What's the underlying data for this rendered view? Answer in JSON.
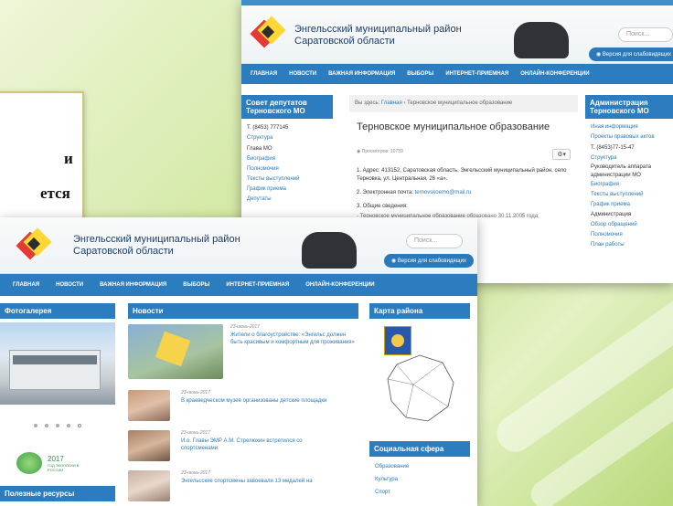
{
  "slide": {
    "line1": "и",
    "line2": "ется"
  },
  "back": {
    "site_line1": "Энгельсский муниципальный район",
    "site_line2": "Саратовской области",
    "search_placeholder": "Поиск...",
    "blind_version": "Версия для слабовидящих",
    "nav": [
      "ГЛАВНАЯ",
      "НОВОСТИ",
      "ВАЖНАЯ ИНФОРМАЦИЯ",
      "ВЫБОРЫ",
      "ИНТЕРНЕТ-ПРИЕМНАЯ",
      "ОНЛАЙН-КОНФЕРЕНЦИИ"
    ],
    "left_title": "Совет депутатов Терновского МО",
    "left_items": [
      "Т. (8453) 777145",
      "Структура",
      "Глава МО",
      "Биография",
      "Полномочия",
      "Тексты выступлений",
      "График приема",
      "Депутаты"
    ],
    "breadcrumb_prefix": "Вы здесь:",
    "breadcrumb_home": "Главная",
    "breadcrumb_current": "Терновское муниципальное образование",
    "page_title": "Терновское муниципальное образование",
    "views": "Просмотров: 10739",
    "para1": "1. Адрес: 413152, Саратовская область, Энгельсский муниципальный район, село Терновка, ул. Центральная, 26 «а».",
    "para2_label": "2. Электронная почта:",
    "para2_email": "ternovskoemo@mail.ru",
    "para3": "3. Общие сведения:",
    "para3_text": "- Терновское муниципальное образование образовано 30.11.2005 года;",
    "right_title": "Администрация Терновского МО",
    "right_items": [
      "Иная информация",
      "Проекты правовых актов",
      "Т. (8453)77-15-47",
      "Структура",
      "Руководитель аппарата администрации МО",
      "Биография",
      "Тексты выступлений",
      "График приема",
      "Администрация",
      "Обзор обращений",
      "Полномочия",
      "План работы"
    ]
  },
  "front": {
    "site_line1": "Энгельсский муниципальный район",
    "site_line2": "Саратовской области",
    "search_placeholder": "Поиск...",
    "blind_version": "Версия для слабовидящих",
    "nav": [
      "ГЛАВНАЯ",
      "НОВОСТИ",
      "ВАЖНАЯ ИНФОРМАЦИЯ",
      "ВЫБОРЫ",
      "ИНТЕРНЕТ-ПРИЕМНАЯ",
      "ОНЛАЙН-КОНФЕРЕНЦИИ"
    ],
    "gallery_title": "Фотогалерея",
    "news_title": "Новости",
    "map_title": "Карта района",
    "social_title": "Социальная сфера",
    "social_items": [
      "Образование",
      "Культура",
      "Спорт"
    ],
    "eco_year": "2017",
    "eco_text": "ГОД ЭКОЛОГИИ В РОССИИ",
    "resources_title": "Полезные ресурсы",
    "news": [
      {
        "date": "23-июнь-2017",
        "title": "Жители о благоустройстве: «Энгельс должен быть красивым и комфортным для проживания»"
      },
      {
        "date": "23-июнь-2017",
        "title": "В краеведческом музее организованы детские площадки"
      },
      {
        "date": "23-июнь-2017",
        "title": "И.о. Главы ЭМР А.М. Стрелюхин встретился со спортсменами"
      },
      {
        "date": "23-июнь-2017",
        "title": "Энгельсские спортсмены завоевали 13 медалей на"
      }
    ]
  }
}
